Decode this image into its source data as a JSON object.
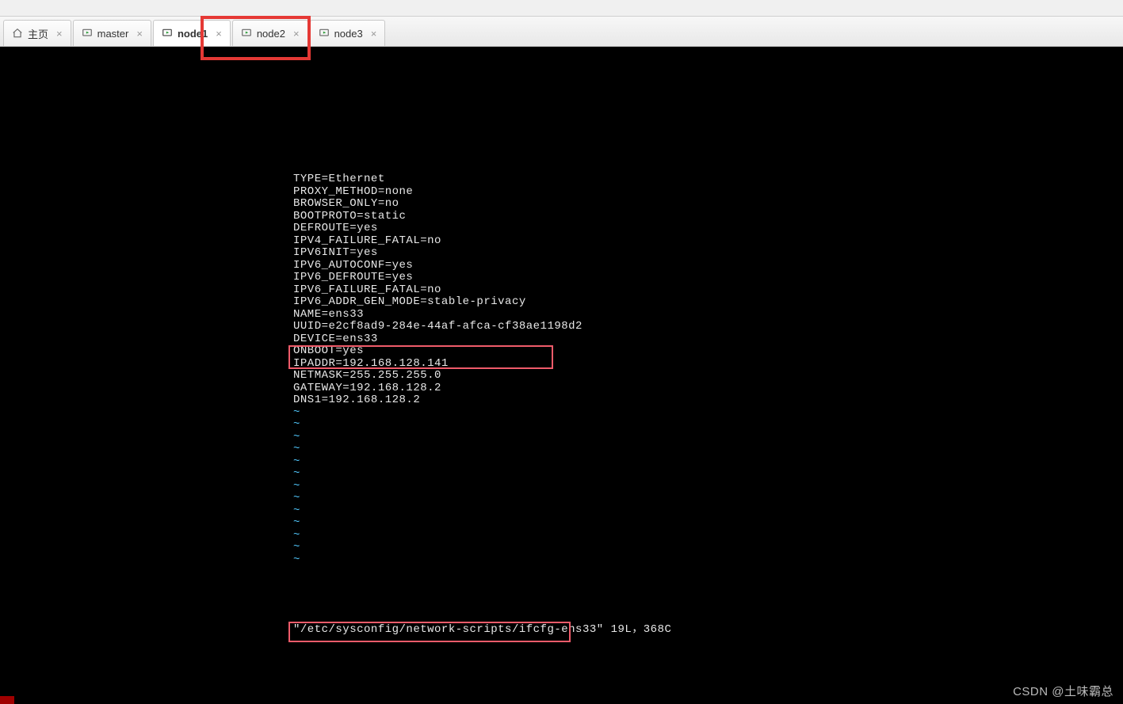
{
  "tabs": [
    {
      "label": "主页",
      "type": "home"
    },
    {
      "label": "master",
      "type": "vm"
    },
    {
      "label": "node1",
      "type": "vm",
      "active": true
    },
    {
      "label": "node2",
      "type": "vm"
    },
    {
      "label": "node3",
      "type": "vm"
    }
  ],
  "close_glyph": "×",
  "terminal_lines": [
    "TYPE=Ethernet",
    "PROXY_METHOD=none",
    "BROWSER_ONLY=no",
    "BOOTPROTO=static",
    "DEFROUTE=yes",
    "IPV4_FAILURE_FATAL=no",
    "IPV6INIT=yes",
    "IPV6_AUTOCONF=yes",
    "IPV6_DEFROUTE=yes",
    "IPV6_FAILURE_FATAL=no",
    "IPV6_ADDR_GEN_MODE=stable-privacy",
    "NAME=ens33",
    "UUID=e2cf8ad9-284e-44af-afca-cf38ae1198d2",
    "DEVICE=ens33",
    "ONBOOT=yes",
    "IPADDR=192.168.128.141",
    "NETMASK=255.255.255.0",
    "GATEWAY=192.168.128.2",
    "DNS1=192.168.128.2"
  ],
  "tilde_count": 13,
  "status": {
    "file": "\"/etc/sysconfig/network-scripts/ifcfg-ens33\"",
    "info": " 19L，368C"
  },
  "watermark": "CSDN @土味霸总"
}
